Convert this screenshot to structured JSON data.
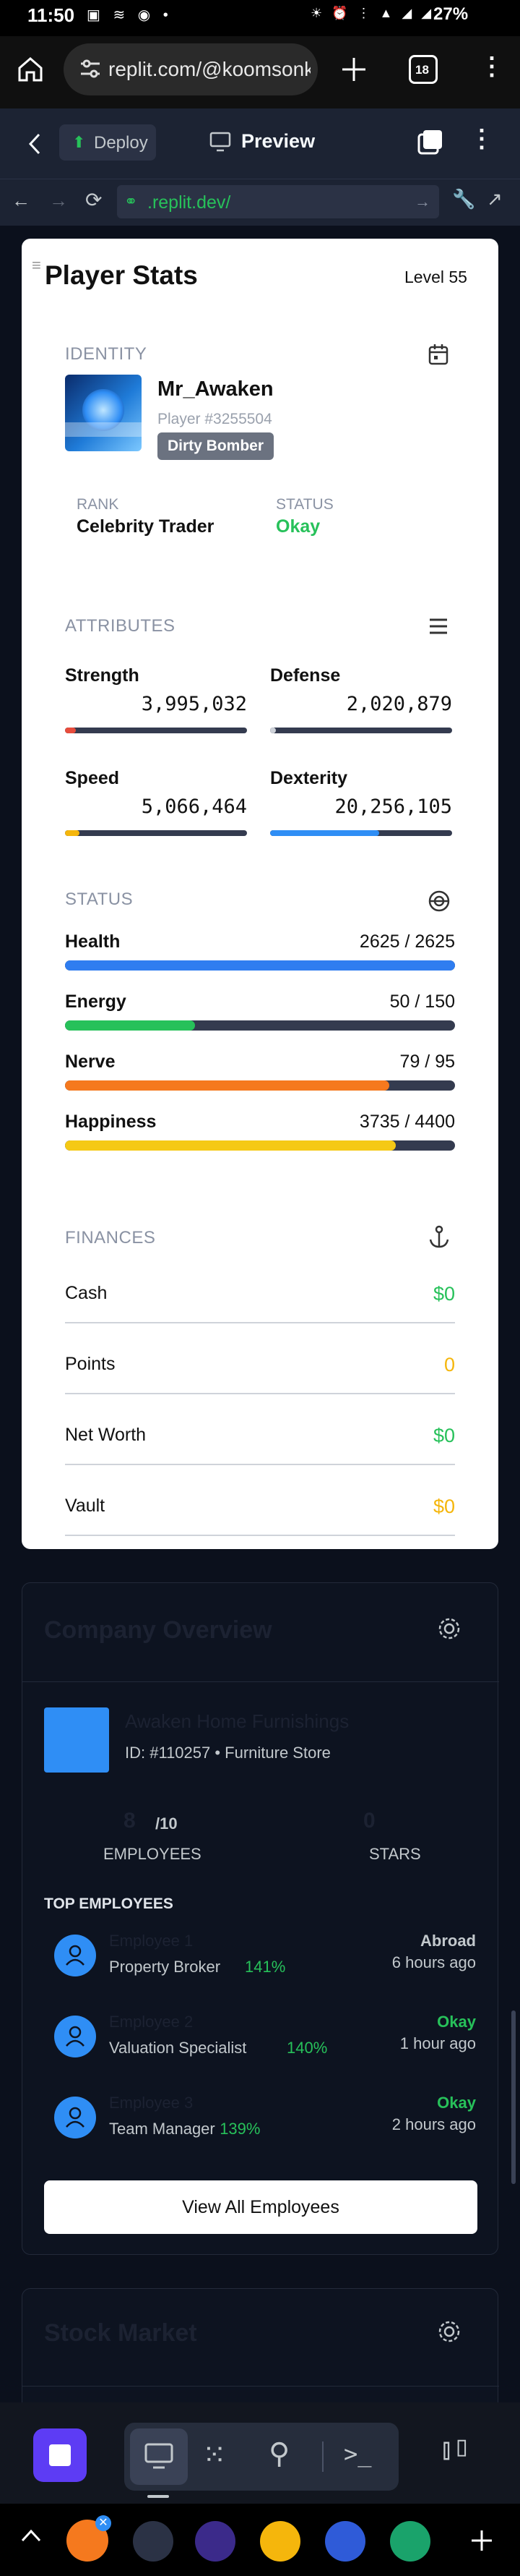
{
  "statusbar": {
    "time": "11:50",
    "battery": "27%",
    "left_icons": "▣ ≋ ◉ •",
    "right_icons": "☀ ⏰ ⋮ ▲ ◢ ◢"
  },
  "browser": {
    "url": "replit.com/@koomsonk",
    "tab_count": "18"
  },
  "replit": {
    "deploy_label": "Deploy",
    "preview_label": "Preview",
    "dev_url": ".replit.dev/"
  },
  "player": {
    "title": "Player Stats",
    "level": "Level 55",
    "identity_label": "IDENTITY",
    "name": "Mr_Awaken",
    "player_id": "Player #3255504",
    "badge": "Dirty Bomber",
    "rank_label": "RANK",
    "rank": "Celebrity Trader",
    "status_label": "STATUS",
    "status": "Okay"
  },
  "attributes": {
    "label": "ATTRIBUTES",
    "items": [
      {
        "name": "Strength",
        "value": "3,995,032",
        "fraction": 0.06,
        "color": "#e74c3c"
      },
      {
        "name": "Defense",
        "value": "2,020,879",
        "fraction": 0.03,
        "color": "#cfd3da"
      },
      {
        "name": "Speed",
        "value": "5,066,464",
        "fraction": 0.08,
        "color": "#f5b60c"
      },
      {
        "name": "Dexterity",
        "value": "20,256,105",
        "fraction": 0.6,
        "color": "#2f8ef5"
      }
    ]
  },
  "status_section": {
    "label": "STATUS",
    "items": [
      {
        "name": "Health",
        "value": "2625 / 2625",
        "fraction": 1.0,
        "color": "#2f7df0"
      },
      {
        "name": "Energy",
        "value": "50 / 150",
        "fraction": 0.333,
        "color": "#27c15a"
      },
      {
        "name": "Nerve",
        "value": "79 / 95",
        "fraction": 0.832,
        "color": "#f5791e"
      },
      {
        "name": "Happiness",
        "value": "3735 / 4400",
        "fraction": 0.849,
        "color": "#f5c915"
      }
    ]
  },
  "finances": {
    "label": "FINANCES",
    "items": [
      {
        "name": "Cash",
        "value": "$0",
        "color": "#27c15a"
      },
      {
        "name": "Points",
        "value": "0",
        "color": "#f5b60c"
      },
      {
        "name": "Net Worth",
        "value": "$0",
        "color": "#27c15a"
      },
      {
        "name": "Vault",
        "value": "$0",
        "color": "#f5b60c"
      }
    ]
  },
  "company": {
    "title": "Company Overview",
    "name": "Awaken Home Furnishings",
    "meta": "ID: #110257 • Furniture Store",
    "employees_value": "8",
    "employees_max": "/10",
    "employees_label": "EMPLOYEES",
    "stars_value": "0",
    "stars_label": "STARS",
    "top_employees_label": "TOP EMPLOYEES",
    "employees": [
      {
        "name": "Employee 1",
        "role": "Property Broker",
        "pct": "141%",
        "status": "Abroad",
        "status_color": "#c2c8cc",
        "ago": "6 hours ago"
      },
      {
        "name": "Employee 2",
        "role": "Valuation Specialist",
        "pct": "140%",
        "status": "Okay",
        "status_color": "#27c15a",
        "ago": "1 hour ago"
      },
      {
        "name": "Employee 3",
        "role": "Team Manager",
        "pct": "139%",
        "status": "Okay",
        "status_color": "#27c15a",
        "ago": "2 hours ago"
      }
    ],
    "view_all": "View All Employees"
  },
  "next_card": {
    "title": "Stock Market"
  },
  "colors": {
    "accent_green": "#27c15a",
    "brand_purple": "#5d3cf4",
    "page_bg": "#0b101c"
  }
}
